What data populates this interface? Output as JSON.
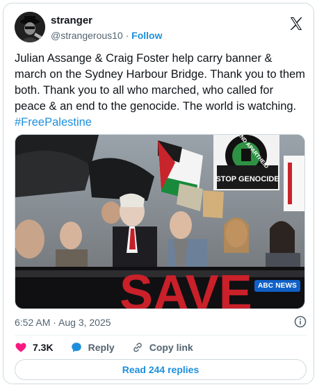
{
  "user": {
    "display_name": "stranger",
    "handle": "@strangerous10",
    "separator": " · ",
    "follow_label": "Follow"
  },
  "tweet": {
    "text": "Julian Assange & Craig Foster help carry banner & march on the Sydney Harbour Bridge. Thank you to them both. Thank you to all who marched, who called for peace & an end to the genocide. The world is watching. ",
    "hashtag": "#FreePalestine"
  },
  "media": {
    "signs": {
      "end_apartheid": "END APARTHEID",
      "stop_genocide": "STOP GENOCIDE",
      "banner": "SAVE"
    },
    "news_badge": "ABC NEWS"
  },
  "meta": {
    "timestamp": "6:52 AM · Aug 3, 2025"
  },
  "actions": {
    "like_count": "7.3K",
    "reply_label": "Reply",
    "copy_link_label": "Copy link"
  },
  "replies_button": "Read 244 replies",
  "colors": {
    "accent": "#1d8fdc",
    "like": "#f91880",
    "muted": "#536471"
  },
  "icons": [
    "x-logo-icon",
    "heart-icon",
    "reply-bubble-icon",
    "link-icon",
    "info-icon"
  ]
}
